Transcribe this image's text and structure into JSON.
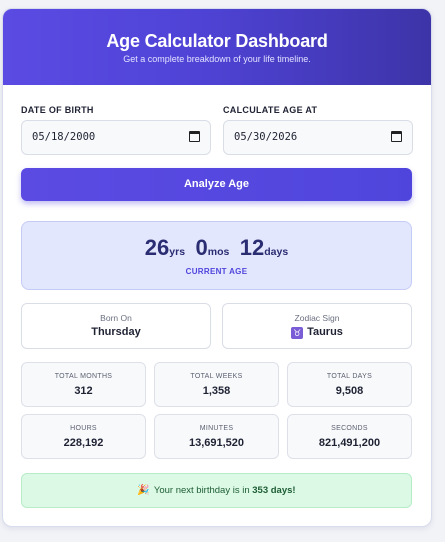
{
  "header": {
    "title": "Age Calculator Dashboard",
    "subtitle": "Get a complete breakdown of your life timeline."
  },
  "inputs": {
    "dob_label": "DATE OF BIRTH",
    "dob_value": "05/18/2000",
    "calc_label": "CALCULATE AGE AT",
    "calc_value": "05/30/2026",
    "icon": "calendar-icon"
  },
  "button": {
    "label": "Analyze Age"
  },
  "age": {
    "years": "26",
    "years_unit": "yrs",
    "months": "0",
    "months_unit": "mos",
    "days": "12",
    "days_unit": "days",
    "caption": "CURRENT AGE"
  },
  "born_on": {
    "label": "Born On",
    "value": "Thursday"
  },
  "zodiac": {
    "label": "Zodiac Sign",
    "value": "Taurus",
    "icon": "taurus-icon",
    "symbol": "♉"
  },
  "stats": [
    {
      "label": "TOTAL MONTHS",
      "value": "312"
    },
    {
      "label": "TOTAL WEEKS",
      "value": "1,358"
    },
    {
      "label": "TOTAL DAYS",
      "value": "9,508"
    },
    {
      "label": "HOURS",
      "value": "228,192"
    },
    {
      "label": "MINUTES",
      "value": "13,691,520"
    },
    {
      "label": "SECONDS",
      "value": "821,491,200"
    }
  ],
  "birthday": {
    "icon": "party-popper-icon",
    "emoji": "🎉",
    "text": "Your next birthday is in",
    "days": "353 days!"
  },
  "colors": {
    "accent": "#5b4be3",
    "age_bg": "#e3e7fd",
    "birthday_bg": "#dcf9e6"
  }
}
